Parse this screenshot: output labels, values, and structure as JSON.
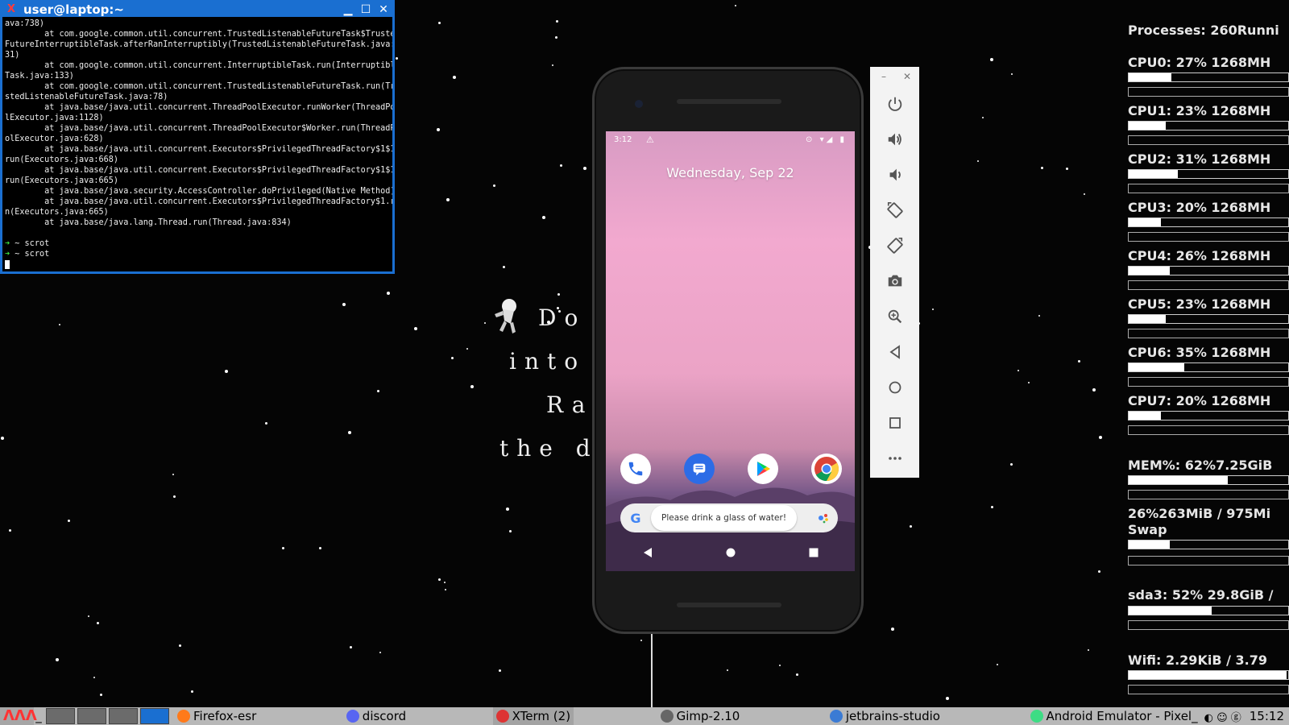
{
  "xterm": {
    "title": "user@laptop:~",
    "lines": [
      "ava:738)",
      "        at com.google.common.util.concurrent.TrustedListenableFutureTask$Trusted",
      "FutureInterruptibleTask.afterRanInterruptibly(TrustedListenableFutureTask.java:1",
      "31)",
      "        at com.google.common.util.concurrent.InterruptibleTask.run(Interruptible",
      "Task.java:133)",
      "        at com.google.common.util.concurrent.TrustedListenableFutureTask.run(Tru",
      "stedListenableFutureTask.java:78)",
      "        at java.base/java.util.concurrent.ThreadPoolExecutor.runWorker(ThreadPoo",
      "lExecutor.java:1128)",
      "        at java.base/java.util.concurrent.ThreadPoolExecutor$Worker.run(ThreadPo",
      "olExecutor.java:628)",
      "        at java.base/java.util.concurrent.Executors$PrivilegedThreadFactory$1$1.",
      "run(Executors.java:668)",
      "        at java.base/java.util.concurrent.Executors$PrivilegedThreadFactory$1$1.",
      "run(Executors.java:665)",
      "        at java.base/java.security.AccessController.doPrivileged(Native Method)",
      "        at java.base/java.util.concurrent.Executors$PrivilegedThreadFactory$1.ru",
      "n(Executors.java:665)",
      "        at java.base/java.lang.Thread.run(Thread.java:834)",
      ""
    ],
    "prompt_symbol": "➜",
    "commands": [
      "~ scrot",
      "~ scrot"
    ]
  },
  "wallpaper": {
    "poem_lines": [
      "Do n",
      "into t",
      "Rage",
      "the dyi"
    ]
  },
  "phone": {
    "status_time": "3:12",
    "status_warning": "⚠",
    "status_icons": "⊙ ▾◢ ▮",
    "date": "Wednesday, Sep 22",
    "search_text": "Please drink a glass of water!",
    "google_letter": "G",
    "dock_apps": [
      "phone-app",
      "messages-app",
      "play-store-app",
      "chrome-app"
    ]
  },
  "emulator_toolbar": {
    "minimize": "–",
    "close": "✕",
    "tools": [
      "power",
      "volume-up",
      "volume-down",
      "rotate-left",
      "rotate-right",
      "camera",
      "zoom",
      "back",
      "home",
      "overview",
      "more"
    ]
  },
  "conky": {
    "processes": "Processes: 260Runni",
    "cpus": [
      {
        "label": "CPU0: 27%  1268MH",
        "percent": 27
      },
      {
        "label": "CPU1: 23%  1268MH",
        "percent": 23
      },
      {
        "label": "CPU2: 31%  1268MH",
        "percent": 31
      },
      {
        "label": "CPU3: 20%  1268MH",
        "percent": 20
      },
      {
        "label": "CPU4: 26%  1268MH",
        "percent": 26
      },
      {
        "label": "CPU5: 23%  1268MH",
        "percent": 23
      },
      {
        "label": "CPU6: 35%  1268MH",
        "percent": 35
      },
      {
        "label": "CPU7: 20%  1268MH",
        "percent": 20
      }
    ],
    "mem": {
      "label": "MEM%: 62%7.25GiB",
      "percent": 62
    },
    "swap": {
      "label1": "26%263MiB / 975Mi",
      "label2": "Swap",
      "percent": 26
    },
    "disk": {
      "label": "sda3: 52%  29.8GiB /",
      "percent": 52
    },
    "wifi": {
      "label": "Wifi: 2.29KiB / 3.79",
      "percent": 99
    }
  },
  "taskbar": {
    "logo": "ΛΛΛ",
    "workspace_separator": "_",
    "tasks": [
      {
        "label": "Firefox-esr",
        "icon": "firefox-icon",
        "color": "#ff7a1a"
      },
      {
        "label": "discord",
        "icon": "discord-icon",
        "color": "#5865f2"
      },
      {
        "label": "XTerm (2)",
        "icon": "xterm-icon",
        "color": "#d33"
      },
      {
        "label": "Gimp-2.10",
        "icon": "gimp-icon",
        "color": "#666"
      },
      {
        "label": "jetbrains-studio",
        "icon": "android-studio-icon",
        "color": "#3b7bd4"
      },
      {
        "label": "Android Emulator - Pixel_",
        "icon": "android-emulator-icon",
        "color": "#3ddc84"
      }
    ],
    "clock": "15:12"
  }
}
